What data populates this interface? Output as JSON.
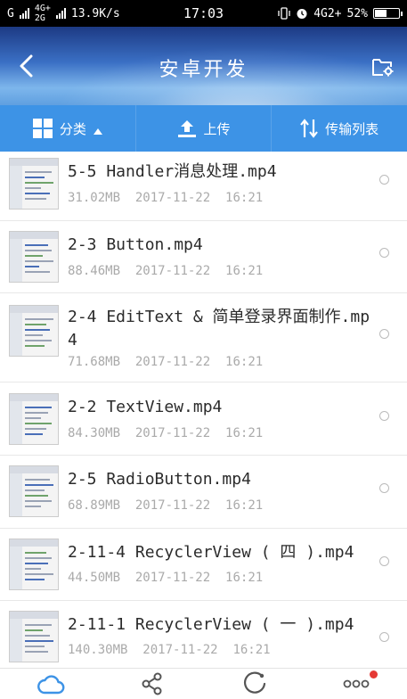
{
  "status_bar": {
    "carrier_left": "G",
    "net_top": "4G+",
    "net_bottom": "2G",
    "speed": "13.9K/s",
    "time": "17:03",
    "net_right": "4G2+",
    "battery": "52%",
    "battery_level": 0.52
  },
  "header": {
    "title": "安卓开发"
  },
  "toolbar": {
    "category_label": "分类",
    "upload_label": "上传",
    "transfer_label": "传输列表"
  },
  "files": [
    {
      "name": "5-5 Handler消息处理.mp4",
      "size": "31.02MB",
      "date": "2017-11-22",
      "time": "16:21"
    },
    {
      "name": "2-3 Button.mp4",
      "size": "88.46MB",
      "date": "2017-11-22",
      "time": "16:21"
    },
    {
      "name": "2-4 EditText & 简单登录界面制作.mp4",
      "size": "71.68MB",
      "date": "2017-11-22",
      "time": "16:21"
    },
    {
      "name": "2-2 TextView.mp4",
      "size": "84.30MB",
      "date": "2017-11-22",
      "time": "16:21"
    },
    {
      "name": "2-5 RadioButton.mp4",
      "size": "68.89MB",
      "date": "2017-11-22",
      "time": "16:21"
    },
    {
      "name": "2-11-4 RecyclerView ( 四 ).mp4",
      "size": "44.50MB",
      "date": "2017-11-22",
      "time": "16:21"
    },
    {
      "name": "2-11-1 RecyclerView ( 一 ).mp4",
      "size": "140.30MB",
      "date": "2017-11-22",
      "time": "16:21"
    }
  ],
  "bottom_nav": {
    "items": [
      "cloud-icon",
      "share-icon",
      "discover-icon",
      "more-icon"
    ],
    "active_color": "#3d93e6",
    "inactive_color": "#555555"
  },
  "colors": {
    "toolbar": "#3d93e6",
    "notification_dot": "#e53935"
  }
}
